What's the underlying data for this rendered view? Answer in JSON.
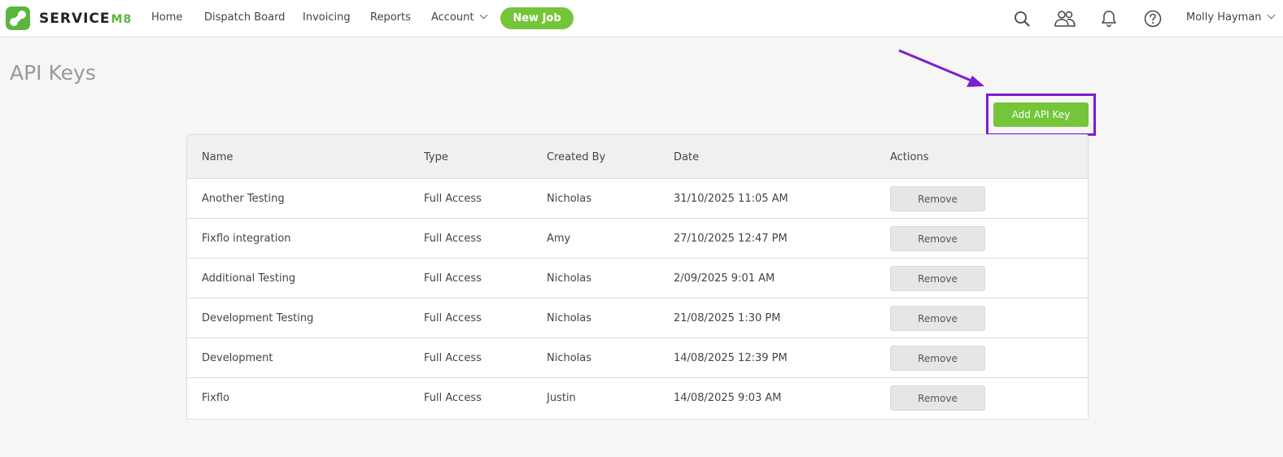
{
  "brand": {
    "name": "SERVICE",
    "suffix": "M8"
  },
  "nav": {
    "home": "Home",
    "dispatch": "Dispatch Board",
    "invoicing": "Invoicing",
    "reports": "Reports",
    "account": "Account",
    "new_job": "New Job"
  },
  "user": {
    "name": "Molly Hayman"
  },
  "page": {
    "title": "API Keys",
    "add_button": "Add API Key"
  },
  "table": {
    "headers": {
      "name": "Name",
      "type": "Type",
      "created_by": "Created By",
      "date": "Date",
      "actions": "Actions"
    },
    "remove_label": "Remove",
    "rows": [
      {
        "name": "Another Testing",
        "type": "Full Access",
        "created_by": "Nicholas",
        "date": "31/10/2025 11:05 AM"
      },
      {
        "name": "Fixflo integration",
        "type": "Full Access",
        "created_by": "Amy",
        "date": "27/10/2025 12:47 PM"
      },
      {
        "name": "Additional Testing",
        "type": "Full Access",
        "created_by": "Nicholas",
        "date": "2/09/2025 9:01 AM"
      },
      {
        "name": "Development Testing",
        "type": "Full Access",
        "created_by": "Nicholas",
        "date": "21/08/2025 1:30 PM"
      },
      {
        "name": "Development",
        "type": "Full Access",
        "created_by": "Nicholas",
        "date": "14/08/2025 12:39 PM"
      },
      {
        "name": "Fixflo",
        "type": "Full Access",
        "created_by": "Justin",
        "date": "14/08/2025 9:03 AM"
      }
    ]
  },
  "colors": {
    "brand_green": "#75c53a",
    "highlight": "#7b1fd0"
  }
}
